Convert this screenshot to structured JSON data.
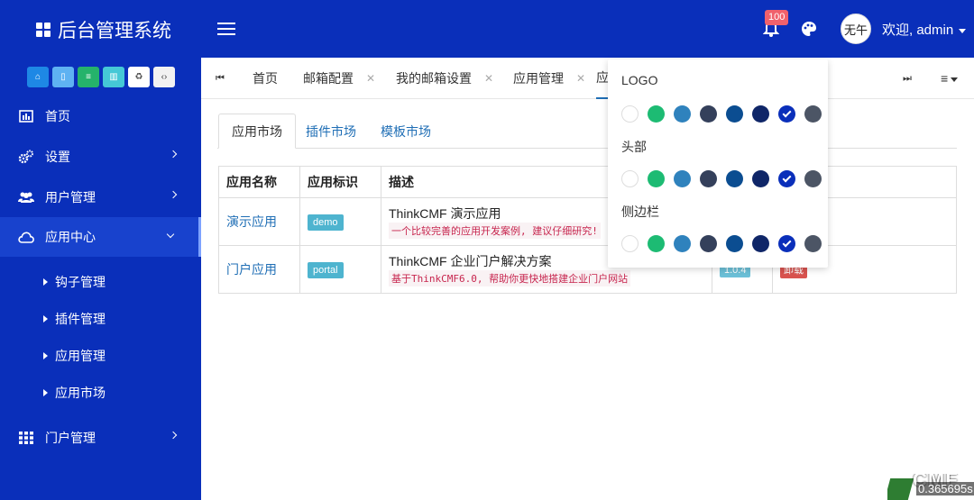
{
  "header": {
    "title": "后台管理系统",
    "notification_count": "100",
    "avatar_text": "无午",
    "welcome": "欢迎, admin"
  },
  "sidebar": {
    "quick_buttons": [
      {
        "icon": "home-icon",
        "color": "#1e88e5"
      },
      {
        "icon": "file-icon",
        "color": "#5eb2f2"
      },
      {
        "icon": "file-text-icon",
        "color": "#25b36b"
      },
      {
        "icon": "trash-icon",
        "color": "#45c8d6"
      },
      {
        "icon": "recycle-icon",
        "color": "#ffffff"
      },
      {
        "icon": "code-icon",
        "color": "#f2f2f2"
      }
    ],
    "items": [
      {
        "label": "首页",
        "icon": "dashboard-icon"
      },
      {
        "label": "设置",
        "icon": "gears-icon"
      },
      {
        "label": "用户管理",
        "icon": "users-icon"
      },
      {
        "label": "应用中心",
        "icon": "cloud-icon"
      },
      {
        "label": "门户管理",
        "icon": "grid-icon"
      }
    ],
    "sub_items": [
      "钩子管理",
      "插件管理",
      "应用管理",
      "应用市场"
    ]
  },
  "tabs": {
    "items": [
      "首页",
      "邮箱配置",
      "我的邮箱设置",
      "应用管理",
      "应"
    ]
  },
  "content": {
    "tabs": [
      "应用市场",
      "插件市场",
      "模板市场"
    ],
    "table": {
      "headers": [
        "应用名称",
        "应用标识",
        "描述",
        "",
        ""
      ],
      "rows": [
        {
          "name": "演示应用",
          "tag": "demo",
          "title": "ThinkCMF 演示应用",
          "desc": "一个比较完善的应用开发案例, 建议仔细研究!",
          "version": "",
          "action": ""
        },
        {
          "name": "门户应用",
          "tag": "portal",
          "title": "ThinkCMF 企业门户解决方案",
          "desc": "基于ThinkCMF6.0, 帮助你更快地搭建企业门户网站",
          "version": "1.0.4",
          "action": "卸载"
        }
      ]
    }
  },
  "theme_popup": {
    "sections": [
      "LOGO",
      "头部",
      "侧边栏"
    ],
    "colors": [
      "#ffffff",
      "#1dbb73",
      "#2f82bd",
      "#34405b",
      "#0b4d91",
      "#0f2668",
      "#0a2fba",
      "#4c5565"
    ],
    "selected_color": "#0a2fba"
  },
  "footer": {
    "brand": "CMF",
    "timing": "0.365695s"
  }
}
